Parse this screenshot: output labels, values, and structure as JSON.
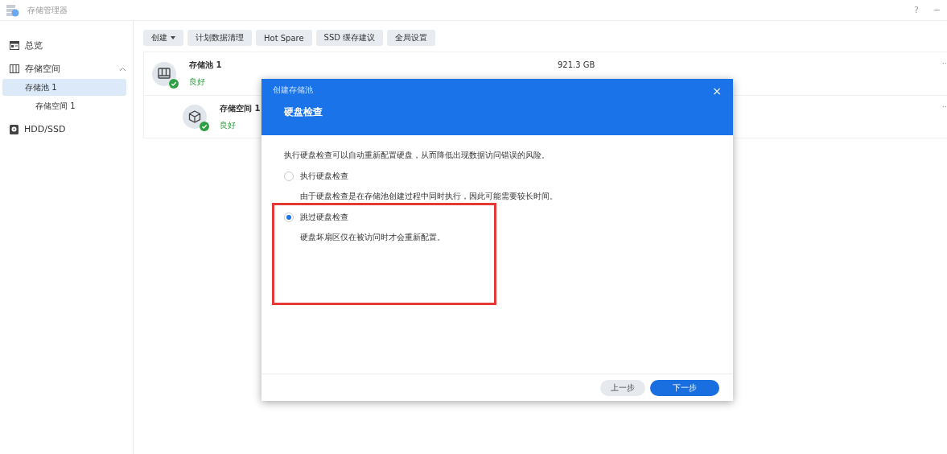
{
  "window": {
    "title": "存储管理器",
    "help": "?",
    "minimize": "−"
  },
  "sidebar": {
    "items": [
      {
        "label": "总览",
        "selected": false
      },
      {
        "label": "存储空间",
        "selected": false,
        "expanded": true,
        "children": [
          {
            "label": "存储池 1",
            "selected": true,
            "children": [
              {
                "label": "存储空间 1",
                "selected": false
              }
            ]
          }
        ]
      },
      {
        "label": "HDD/SSD",
        "selected": false
      }
    ]
  },
  "toolbar": [
    {
      "label": "创建",
      "dropdown": true
    },
    {
      "label": "计划数据清理",
      "dropdown": false
    },
    {
      "label": "Hot Spare",
      "dropdown": false
    },
    {
      "label": "SSD 缓存建议",
      "dropdown": false
    },
    {
      "label": "全局设置",
      "dropdown": false
    }
  ],
  "list": [
    {
      "kind": "pool",
      "name": "存储池 1",
      "status": "良好",
      "size": "921.3 GB",
      "more": "··"
    },
    {
      "kind": "volume",
      "name": "存储空间 1",
      "status": "良好",
      "more": "··"
    }
  ],
  "dialog": {
    "caption": "创建存储池",
    "close": "×",
    "title": "硬盘检查",
    "intro": "执行硬盘检查可以自动重新配置硬盘，从而降低出现数据访问错误的风险。",
    "options": [
      {
        "label": "执行硬盘检查",
        "selected": false,
        "note": "由于硬盘检查是在存储池创建过程中同时执行，因此可能需要较长时间。"
      },
      {
        "label": "跳过硬盘检查",
        "selected": true,
        "note": "硬盘坏扇区仅在被访问时才会重新配置。"
      }
    ],
    "buttons": [
      {
        "label": "上一步",
        "kind": "secondary"
      },
      {
        "label": "下一步",
        "kind": "primary"
      }
    ]
  }
}
